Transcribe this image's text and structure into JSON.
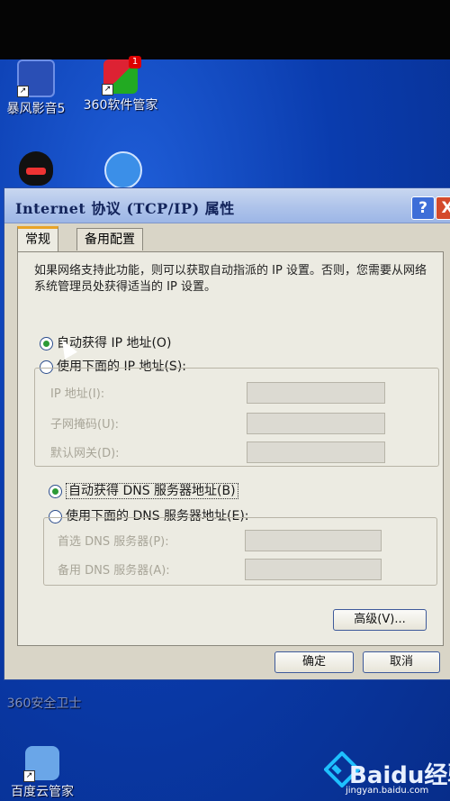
{
  "desktop": {
    "icons": [
      {
        "label": "暴风影音5",
        "icon": "baofeng-icon"
      },
      {
        "label": "360软件管家",
        "icon": "360-software-manager-icon",
        "badge": "1"
      },
      {
        "label": "",
        "icon": "qq-penguin-icon"
      },
      {
        "label": "",
        "icon": "browser-icon"
      },
      {
        "label": "360安全卫士",
        "icon": "360-security-icon"
      },
      {
        "label": "百度云管家",
        "icon": "baidu-cloud-icon"
      }
    ]
  },
  "dialog": {
    "title": "Internet 协议 (TCP/IP) 属性",
    "help_glyph": "?",
    "close_glyph": "X",
    "tabs": [
      {
        "label": "常规",
        "active": true
      },
      {
        "label": "备用配置",
        "active": false
      }
    ],
    "description": "如果网络支持此功能，则可以获取自动指派的 IP 设置。否则，您需要从网络系统管理员处获得适当的 IP 设置。",
    "ip": {
      "auto_label": "自动获得 IP 地址(O)",
      "manual_label": "使用下面的 IP 地址(S):",
      "auto_selected": true,
      "fields": [
        {
          "label": "IP 地址(I):",
          "value": ""
        },
        {
          "label": "子网掩码(U):",
          "value": ""
        },
        {
          "label": "默认网关(D):",
          "value": ""
        }
      ]
    },
    "dns": {
      "auto_label": "自动获得 DNS 服务器地址(B)",
      "manual_label": "使用下面的 DNS 服务器地址(E):",
      "auto_selected": true,
      "fields": [
        {
          "label": "首选 DNS 服务器(P):",
          "value": ""
        },
        {
          "label": "备用 DNS 服务器(A):",
          "value": ""
        }
      ]
    },
    "advanced_label": "高级(V)...",
    "ok_label": "确定",
    "cancel_label": "取消"
  },
  "watermark": {
    "text": "Baidu经验",
    "url": "jingyan.baidu.com"
  },
  "colors": {
    "desktop": "#0b3aa6",
    "dialog_bg": "#d9d5c7",
    "titlebar": "#aec3ea",
    "tab_accent": "#e8a428",
    "radio_checked": "#2c9a36"
  }
}
